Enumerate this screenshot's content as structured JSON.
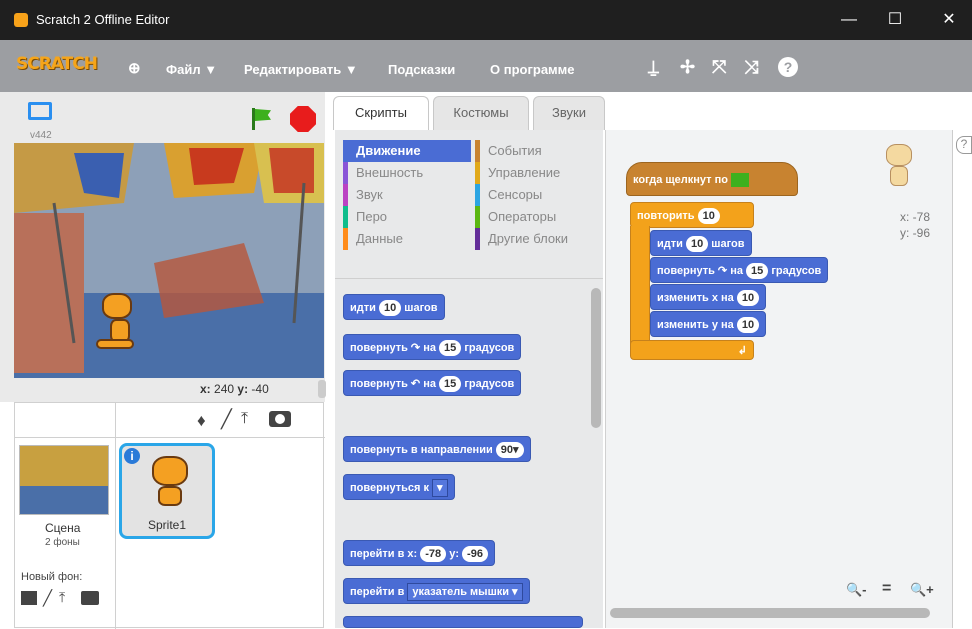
{
  "window": {
    "title": "Scratch 2 Offline Editor",
    "min": "—",
    "max": "☐",
    "close": "✕"
  },
  "menu": {
    "logo": "SCRATCH",
    "file": "Файл ▼",
    "edit": "Редактировать ▼",
    "tips": "Подсказки",
    "about": "О программе",
    "globe": "⊕"
  },
  "tools": [
    "⍊",
    "✢",
    "⤧",
    "⤨",
    "?"
  ],
  "stage": {
    "version": "v442",
    "coords_x_label": "x:",
    "coords_x": "240",
    "coords_y_label": "y:",
    "coords_y": "-40"
  },
  "sprites": {
    "stage_label": "Сцена",
    "backdrops": "2 фоны",
    "new_backdrop": "Новый фон:",
    "sprite1": "Sprite1",
    "info": "i"
  },
  "tabs": [
    "Скрипты",
    "Костюмы",
    "Звуки"
  ],
  "categories_left": [
    "Движение",
    "Внешность",
    "Звук",
    "Перо",
    "Данные"
  ],
  "categories_right": [
    "События",
    "Управление",
    "Сенсоры",
    "Операторы",
    "Другие блоки"
  ],
  "cat_colors_left": [
    "#4a6cd4",
    "#8a55d7",
    "#bb42c3",
    "#0fbd8c",
    "#ff8c1a"
  ],
  "cat_colors_right": [
    "#c88330",
    "#e1a91a",
    "#2ca5e2",
    "#5cb712",
    "#632d99"
  ],
  "palette": {
    "move": "идти",
    "move_val": "10",
    "steps": "шагов",
    "turn_r": "повернуть ↷ на",
    "turn_val": "15",
    "degrees": "градусов",
    "turn_l": "повернуть ↶ на",
    "point_dir": "повернуть в направлении",
    "dir_val": "90▾",
    "point_to": "повернуться к",
    "point_to_dd": "▾",
    "goto_xy": "перейти в x:",
    "goto_x": "-78",
    "y_label": "y:",
    "goto_y": "-96",
    "goto": "перейти в",
    "goto_dd": "указатель мышки ▾"
  },
  "script": {
    "hat": "когда щелкнут по",
    "repeat": "повторить",
    "repeat_val": "10",
    "move": "идти",
    "move_val": "10",
    "steps": "шагов",
    "turn": "повернуть ↷ на",
    "turn_val": "15",
    "degrees": "градусов",
    "chx": "изменить x на",
    "chx_val": "10",
    "chy": "изменить y на",
    "chy_val": "10",
    "loop_arrow": "↲",
    "sprite_x": "x: -78",
    "sprite_y": "y: -96"
  },
  "zoom": {
    "out": "🔍-",
    "reset": "=",
    "in": "🔍+"
  }
}
